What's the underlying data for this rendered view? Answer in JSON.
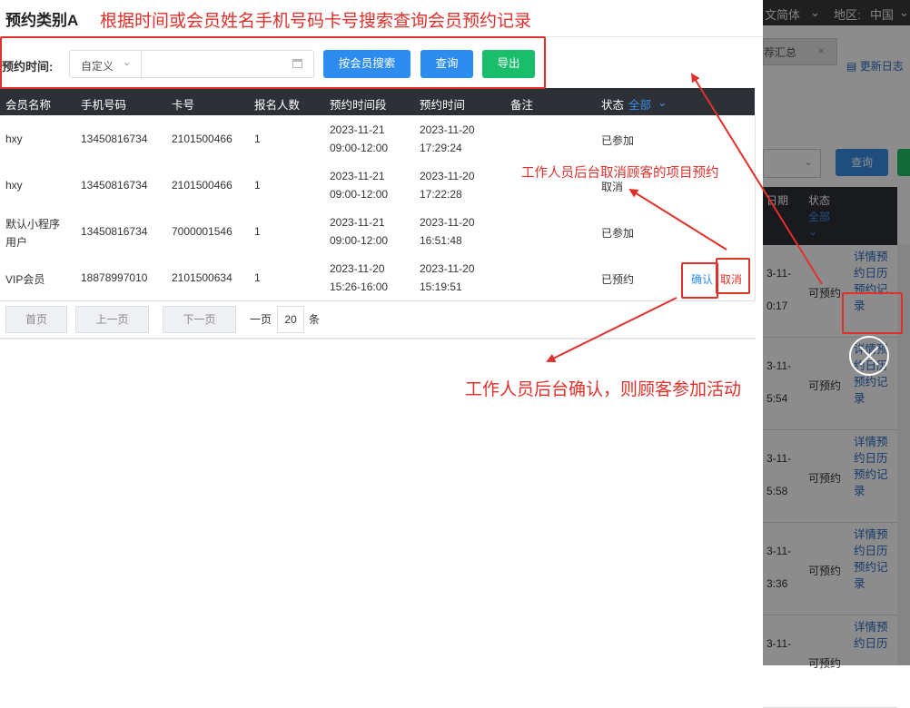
{
  "background": {
    "top_bar": {
      "lang": "文简体",
      "region_label": "地区:",
      "region_value": "中国"
    },
    "tab": {
      "label": "荐汇总",
      "close": "×"
    },
    "update_log": "更新日志",
    "query_button": "查询",
    "header": {
      "col_date": "日期",
      "col_status": "状态",
      "status_filter": "全部"
    },
    "rows": [
      {
        "date1": "3-11-",
        "date2": "0:17",
        "status": "可预约",
        "links": "详情预约日历预约记录"
      },
      {
        "date1": "3-11-",
        "date2": "5:54",
        "status": "可预约",
        "links": "详情预约日历预约记录"
      },
      {
        "date1": "3-11-",
        "date2": "5:58",
        "status": "可预约",
        "links": "详情预约日历预约记录"
      },
      {
        "date1": "3-11-",
        "date2": "3:36",
        "status": "可预约",
        "links": "详情预约日历预约记录"
      },
      {
        "date1": "3-11-",
        "date2": "",
        "status": "可预约",
        "links": "详情预约日历"
      }
    ]
  },
  "modal": {
    "title": "预约类别A",
    "toolbar": {
      "label": "预约时间:",
      "date_type": "自定义",
      "date_range_value": "",
      "btn_member_search": "按会员搜索",
      "btn_query": "查询",
      "btn_export": "导出"
    },
    "table": {
      "headers": [
        "会员名称",
        "手机号码",
        "卡号",
        "报名人数",
        "预约时间段",
        "预约时间",
        "备注",
        "状态"
      ],
      "status_filter": "全部",
      "rows": [
        {
          "name": "hxy",
          "name2": "",
          "phone": "13450816734",
          "card": "2101500466",
          "count": "1",
          "slot_date": "2023-11-21",
          "slot_time": "09:00-12:00",
          "book_date": "2023-11-20",
          "book_time": "17:29:24",
          "note": "",
          "status": "已参加",
          "confirm": "",
          "cancel": ""
        },
        {
          "name": "hxy",
          "name2": "",
          "phone": "13450816734",
          "card": "2101500466",
          "count": "1",
          "slot_date": "2023-11-21",
          "slot_time": "09:00-12:00",
          "book_date": "2023-11-20",
          "book_time": "17:22:28",
          "note": "",
          "status": "取消",
          "confirm": "",
          "cancel": ""
        },
        {
          "name": "默认小程序",
          "name2": "用户",
          "phone": "13450816734",
          "card": "7000001546",
          "count": "1",
          "slot_date": "2023-11-21",
          "slot_time": "09:00-12:00",
          "book_date": "2023-11-20",
          "book_time": "16:51:48",
          "note": "",
          "status": "已参加",
          "confirm": "",
          "cancel": ""
        },
        {
          "name": "VIP会员",
          "name2": "",
          "phone": "18878997010",
          "card": "2101500634",
          "count": "1",
          "slot_date": "2023-11-20",
          "slot_time": "15:26-16:00",
          "book_date": "2023-11-20",
          "book_time": "15:19:51",
          "note": "",
          "status": "已预约",
          "confirm": "确认",
          "cancel": "取消"
        }
      ]
    },
    "pagination": {
      "first": "首页",
      "prev": "上一页",
      "next": "下一页",
      "per_page_label": "一页",
      "page_size": "20",
      "unit": "条"
    }
  },
  "annotations": {
    "title_note": "根据时间或会员姓名手机号码卡号搜索查询会员预约记录",
    "cancel_note": "工作人员后台取消顾客的项目预约",
    "confirm_note": "工作人员后台确认，则顾客参加活动"
  },
  "colors": {
    "accent": "#2d8cf0",
    "export": "#19be6b",
    "annotation": "#e0302a",
    "table_header": "#2e3038"
  }
}
